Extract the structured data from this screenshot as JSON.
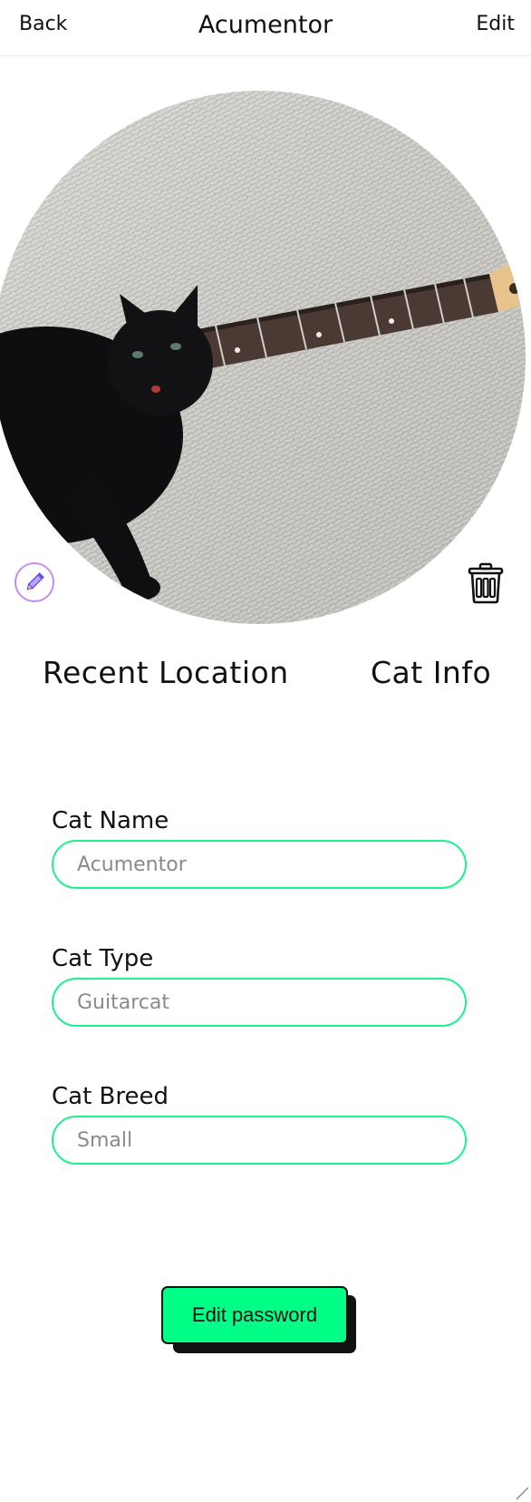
{
  "nav": {
    "back_label": "Back",
    "title": "Acumentor",
    "edit_label": "Edit"
  },
  "photo": {
    "subject": "black cat lying next to guitar neck",
    "edit_icon": "pencil-icon",
    "delete_icon": "trash-icon"
  },
  "tabs": [
    {
      "label": "Recent Location"
    },
    {
      "label": "Cat Info"
    }
  ],
  "form": {
    "fields": [
      {
        "label": "Cat Name",
        "value": "Acumentor"
      },
      {
        "label": "Cat Type",
        "value": "Guitarcat"
      },
      {
        "label": "Cat Breed",
        "value": "Small"
      }
    ]
  },
  "actions": {
    "edit_password_label": "Edit password"
  },
  "colors": {
    "accent": "#00ff87",
    "input_border": "#1ff08a",
    "pencil_ring": "#c58cf3",
    "text": "#111111"
  }
}
